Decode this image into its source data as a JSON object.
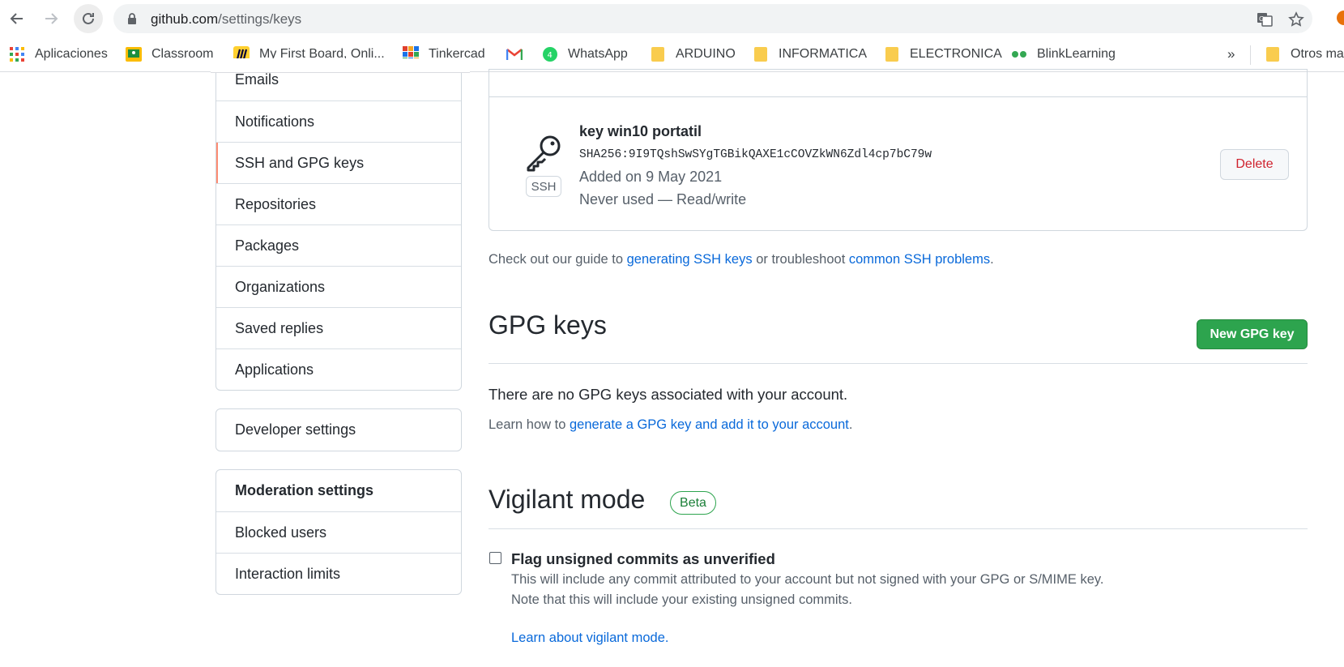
{
  "browser": {
    "url_host": "github.com",
    "url_path": "/settings/keys",
    "bookmarks": [
      {
        "label": "Aplicaciones",
        "icon": "apps-grid-icon"
      },
      {
        "label": "Classroom",
        "icon": "classroom-icon"
      },
      {
        "label": "My First Board, Onli...",
        "icon": "miro-icon"
      },
      {
        "label": "Tinkercad",
        "icon": "tinkercad-icon"
      },
      {
        "label": "",
        "icon": "gmail-icon"
      },
      {
        "label": "WhatsApp",
        "icon": "whatsapp-icon"
      },
      {
        "label": "ARDUINO",
        "icon": "folder-icon"
      },
      {
        "label": "INFORMATICA",
        "icon": "folder-icon"
      },
      {
        "label": "ELECTRONICA",
        "icon": "folder-icon"
      },
      {
        "label": "BlinkLearning",
        "icon": "blinklearning-icon"
      }
    ],
    "more_label": "»",
    "other_bookmarks": "Otros ma"
  },
  "sidebar": {
    "items": [
      {
        "label": "Emails"
      },
      {
        "label": "Notifications"
      },
      {
        "label": "SSH and GPG keys"
      },
      {
        "label": "Repositories"
      },
      {
        "label": "Packages"
      },
      {
        "label": "Organizations"
      },
      {
        "label": "Saved replies"
      },
      {
        "label": "Applications"
      }
    ],
    "developer": "Developer settings",
    "moderation": {
      "heading": "Moderation settings",
      "items": [
        {
          "label": "Blocked users"
        },
        {
          "label": "Interaction limits"
        }
      ]
    }
  },
  "ssh_key": {
    "title": "key win10 portatil",
    "fingerprint": "SHA256:9I9TQshSwSYgTGBikQAXE1cCOVZkWN6Zdl4cp7bC79w",
    "added": "Added on 9 May 2021",
    "usage": "Never used — Read/write",
    "type_label": "SSH",
    "delete_label": "Delete"
  },
  "guide": {
    "prefix": "Check out our guide to ",
    "link1": "generating SSH keys",
    "middle": " or troubleshoot ",
    "link2": "common SSH problems",
    "suffix": "."
  },
  "gpg": {
    "title": "GPG keys",
    "new_button": "New GPG key",
    "empty": "There are no GPG keys associated with your account.",
    "learn_prefix": "Learn how to ",
    "learn_link": "generate a GPG key and add it to your account",
    "learn_suffix": "."
  },
  "vigilant": {
    "title": "Vigilant mode",
    "badge": "Beta",
    "checkbox_label": "Flag unsigned commits as unverified",
    "note_line1": "This will include any commit attributed to your account but not signed with your GPG or S/MIME key.",
    "note_line2": "Note that this will include your existing unsigned commits.",
    "learn_link": "Learn about vigilant mode."
  },
  "colors": {
    "link": "#0969da",
    "primary_button": "#2da44e",
    "danger": "#cf222e",
    "active_marker": "#fd8c73"
  }
}
